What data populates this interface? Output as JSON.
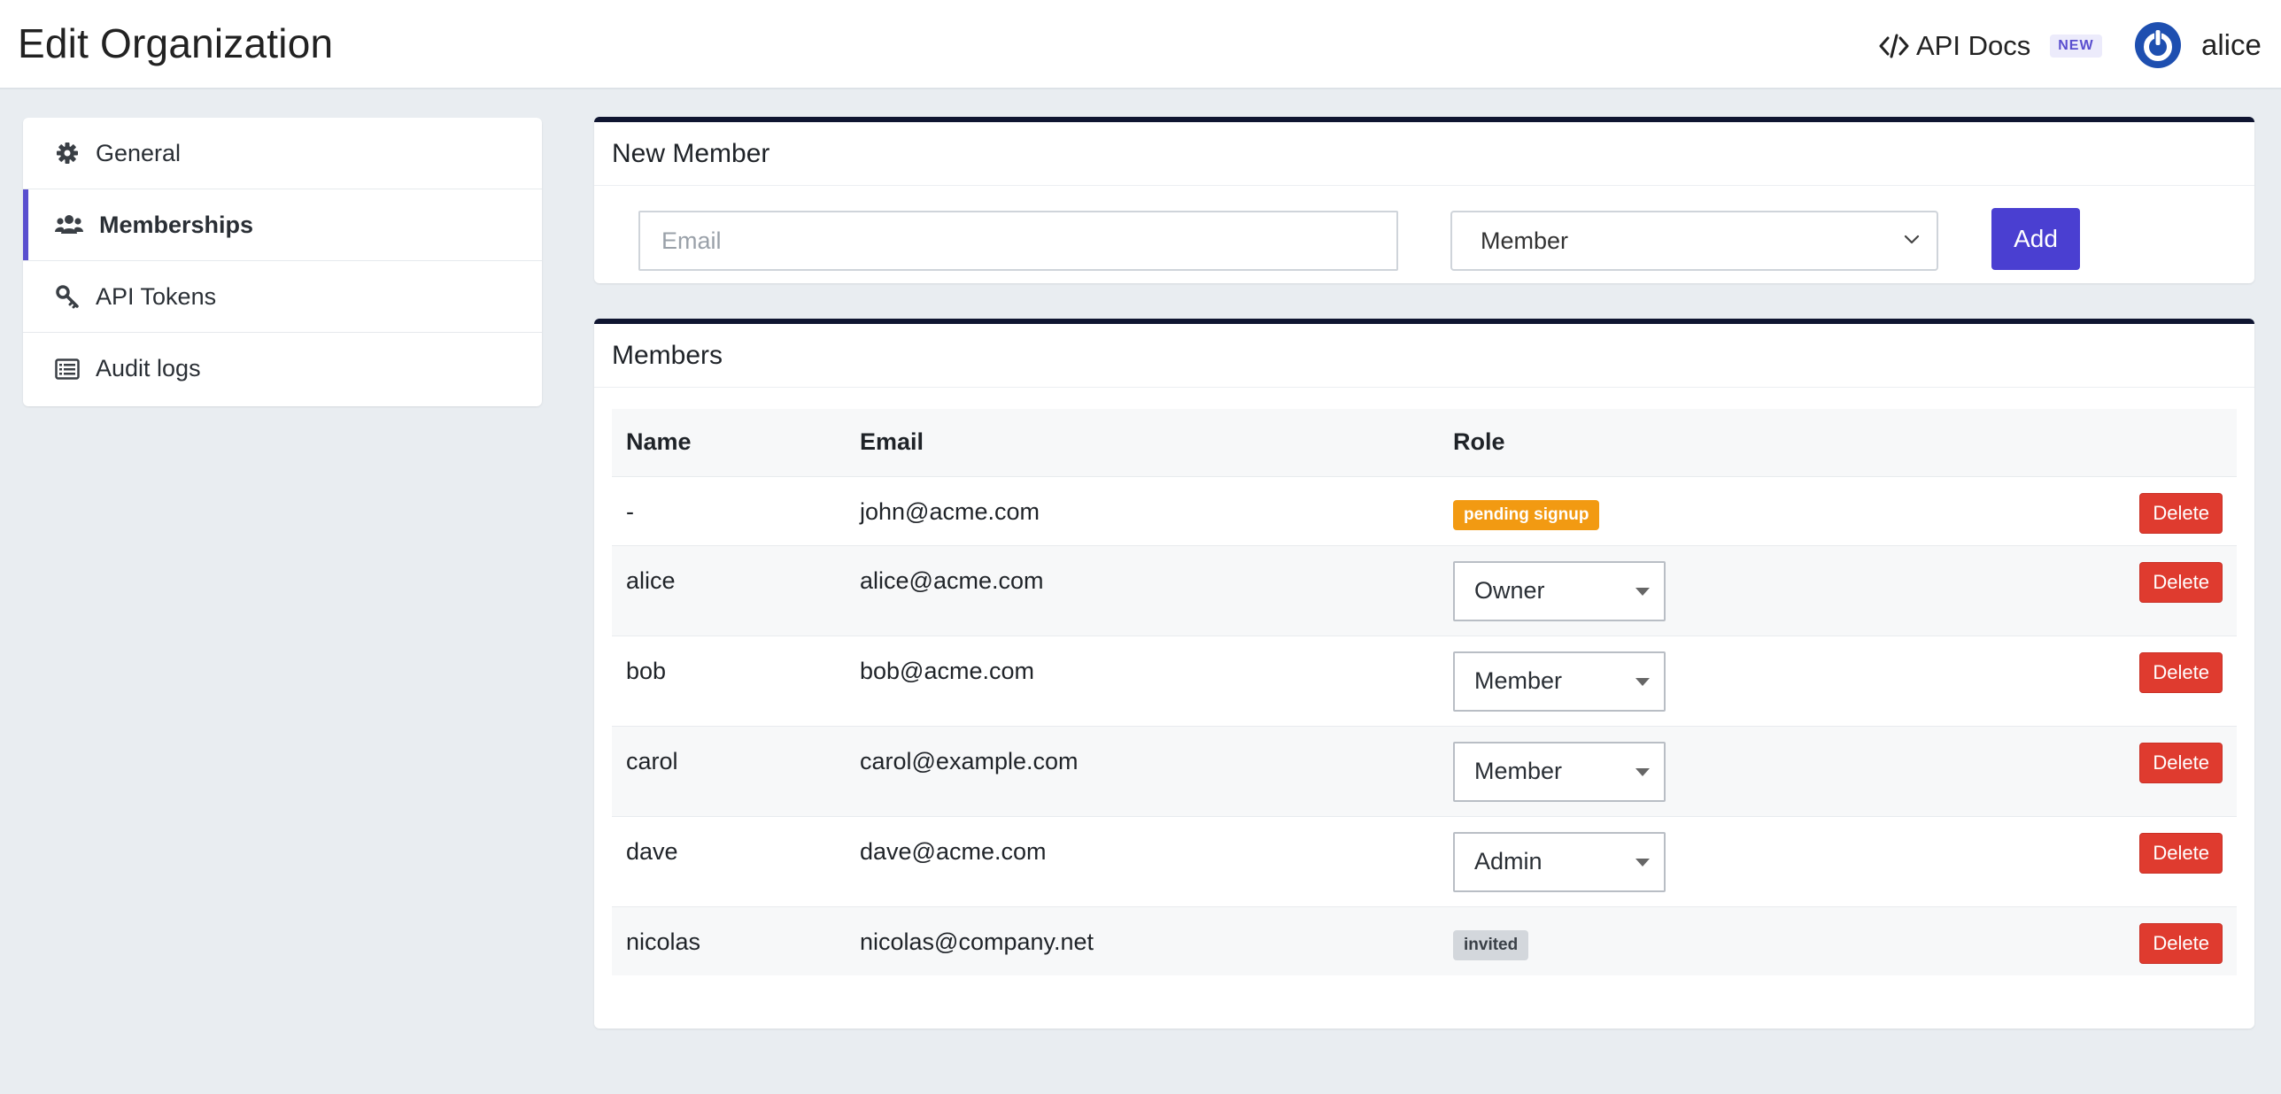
{
  "header": {
    "title": "Edit Organization",
    "api_docs_label": "API Docs",
    "new_badge": "NEW",
    "user_name": "alice"
  },
  "sidebar": {
    "items": [
      {
        "label": "General",
        "icon": "gear-icon",
        "active": false
      },
      {
        "label": "Memberships",
        "icon": "users-icon",
        "active": true
      },
      {
        "label": "API Tokens",
        "icon": "key-icon",
        "active": false
      },
      {
        "label": "Audit logs",
        "icon": "list-icon",
        "active": false
      }
    ]
  },
  "new_member": {
    "title": "New Member",
    "email_placeholder": "Email",
    "email_value": "",
    "role_selected": "Member",
    "add_label": "Add"
  },
  "members": {
    "title": "Members",
    "columns": {
      "name": "Name",
      "email": "Email",
      "role": "Role"
    },
    "delete_label": "Delete",
    "rows": [
      {
        "name": "-",
        "email": "john@acme.com",
        "role_type": "badge",
        "role": "pending signup"
      },
      {
        "name": "alice",
        "email": "alice@acme.com",
        "role_type": "select",
        "role": "Owner"
      },
      {
        "name": "bob",
        "email": "bob@acme.com",
        "role_type": "select",
        "role": "Member"
      },
      {
        "name": "carol",
        "email": "carol@example.com",
        "role_type": "select",
        "role": "Member"
      },
      {
        "name": "dave",
        "email": "dave@acme.com",
        "role_type": "select",
        "role": "Admin"
      },
      {
        "name": "nicolas",
        "email": "nicolas@company.net",
        "role_type": "badge",
        "role": "invited"
      }
    ]
  },
  "colors": {
    "accent": "#4a3fd1",
    "card_top_border": "#0f1531",
    "delete": "#df3b2f",
    "pending_badge": "#f29a12",
    "invited_badge": "#d3d7dc"
  }
}
